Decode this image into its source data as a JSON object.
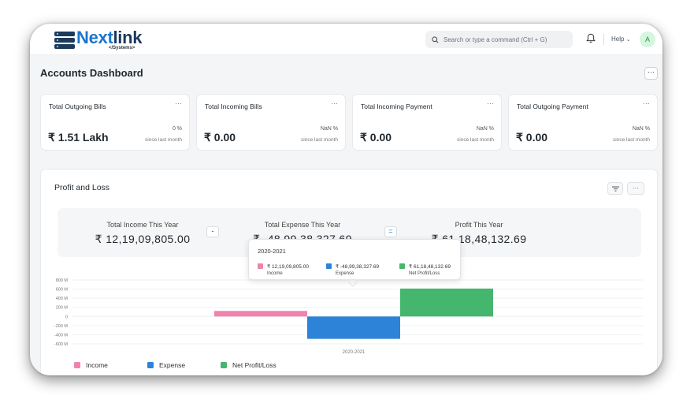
{
  "brand": {
    "name_main": "Next",
    "name_accent": "link",
    "tagline": "</Systems>"
  },
  "navbar": {
    "search_placeholder": "Search or type a command (Ctrl + G)",
    "help_label": "Help",
    "avatar_initial": "A"
  },
  "page": {
    "title": "Accounts Dashboard",
    "menu_label": "···"
  },
  "cards": [
    {
      "title": "Total Outgoing Bills",
      "value": "₹ 1.51 Lakh",
      "change": "0 %",
      "since": "since last month"
    },
    {
      "title": "Total Incoming Bills",
      "value": "₹ 0.00",
      "change": "NaN %",
      "since": "since last month"
    },
    {
      "title": "Total Incoming Payment",
      "value": "₹ 0.00",
      "change": "NaN %",
      "since": "since last month"
    },
    {
      "title": "Total Outgoing Payment",
      "value": "₹ 0.00",
      "change": "NaN %",
      "since": "since last month"
    }
  ],
  "card_menu_label": "···",
  "profit_and_loss": {
    "title": "Profit and Loss",
    "more_label": "···",
    "summary": {
      "income_label": "Total Income This Year",
      "income_value": "₹ 12,19,09,805.00",
      "minus": "-",
      "expense_label": "Total Expense This Year",
      "expense_value": "₹ -48,99,38,327.69",
      "equals": "=",
      "profit_label": "Profit This Year",
      "profit_value": "₹ 61,18,48,132.69"
    },
    "tooltip": {
      "title": "2020-2021",
      "entries": [
        {
          "value": "₹ 12,19,09,805.00",
          "name": "Income"
        },
        {
          "value": "₹ -48,99,38,327.69",
          "name": "Expense"
        },
        {
          "value": "₹ 61,18,48,132.69",
          "name": "Net Profit/Loss"
        }
      ]
    }
  },
  "colors": {
    "income": "#f083ae",
    "expense": "#2c83d8",
    "profit": "#45b66e",
    "brand": "#1b75d0"
  },
  "chart_data": {
    "type": "bar",
    "categories": [
      "2020-2021"
    ],
    "series": [
      {
        "name": "Income",
        "values": [
          121909805.0
        ]
      },
      {
        "name": "Expense",
        "values": [
          -489938327.69
        ]
      },
      {
        "name": "Net Profit/Loss",
        "values": [
          611848132.69
        ]
      }
    ],
    "y_ticks": [
      "800 M",
      "600 M",
      "400 M",
      "200 M",
      "0",
      "-200 M",
      "-400 M",
      "-600 M"
    ],
    "ylim": [
      -600000000,
      800000000
    ],
    "grid": true,
    "legend_position": "bottom-left"
  }
}
